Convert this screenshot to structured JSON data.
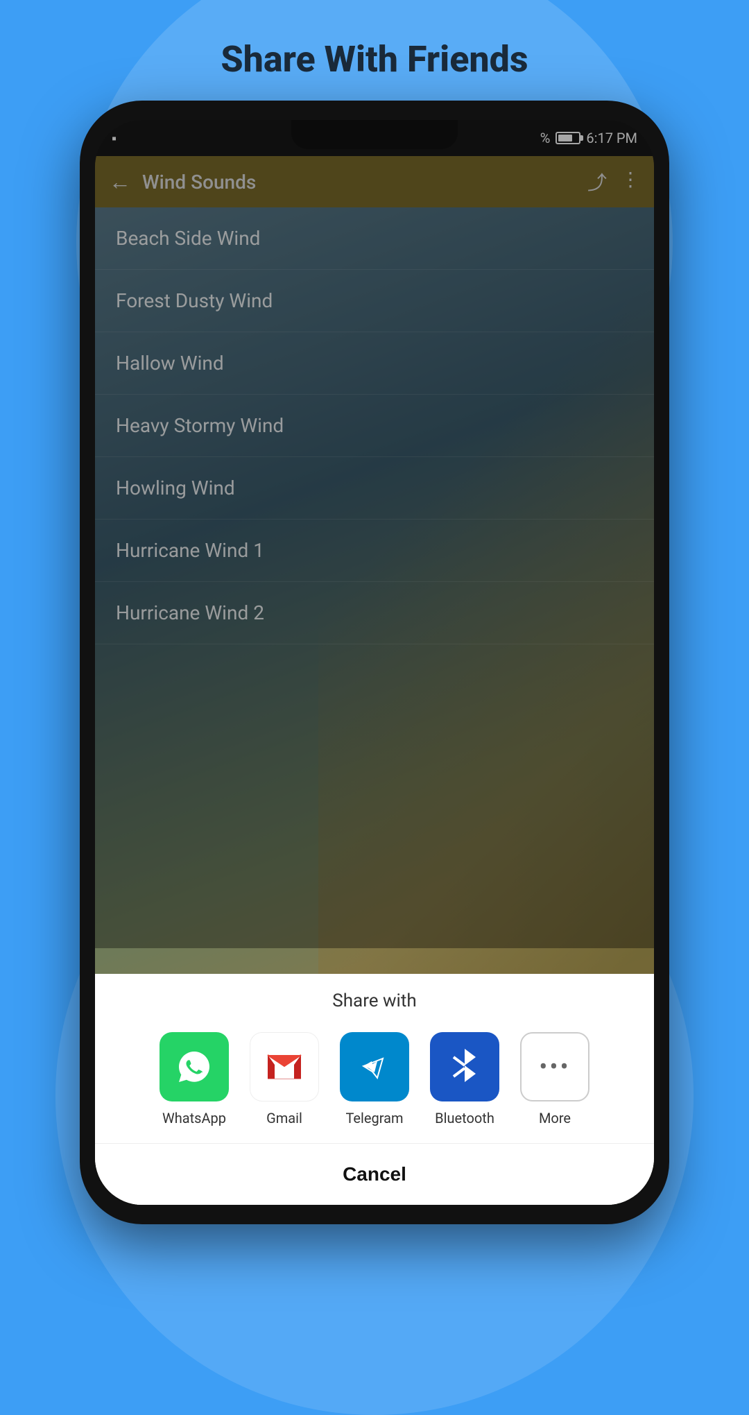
{
  "page": {
    "title": "Share With Friends",
    "background_color": "#3d9ef5"
  },
  "status_bar": {
    "time": "6:17 PM",
    "battery_percent": "%"
  },
  "app_bar": {
    "title": "Wind Sounds",
    "back_label": "←",
    "share_label": "⤴",
    "more_label": "⋮"
  },
  "sound_list": {
    "items": [
      {
        "id": 1,
        "label": "Beach Side Wind"
      },
      {
        "id": 2,
        "label": "Forest Dusty Wind"
      },
      {
        "id": 3,
        "label": "Hallow Wind"
      },
      {
        "id": 4,
        "label": "Heavy Stormy Wind"
      },
      {
        "id": 5,
        "label": "Howling Wind"
      },
      {
        "id": 6,
        "label": "Hurricane Wind 1"
      },
      {
        "id": 7,
        "label": "Hurricane Wind 2"
      }
    ]
  },
  "share_sheet": {
    "title": "Share with",
    "apps": [
      {
        "id": "whatsapp",
        "label": "WhatsApp",
        "icon_type": "whatsapp",
        "color": "#25d366"
      },
      {
        "id": "gmail",
        "label": "Gmail",
        "icon_type": "gmail",
        "color": "#ffffff"
      },
      {
        "id": "telegram",
        "label": "Telegram",
        "icon_type": "telegram",
        "color": "#0088cc"
      },
      {
        "id": "bluetooth",
        "label": "Bluetooth",
        "icon_type": "bluetooth",
        "color": "#1a56c4"
      },
      {
        "id": "more",
        "label": "More",
        "icon_type": "more",
        "color": "#ffffff"
      }
    ],
    "cancel_label": "Cancel"
  }
}
